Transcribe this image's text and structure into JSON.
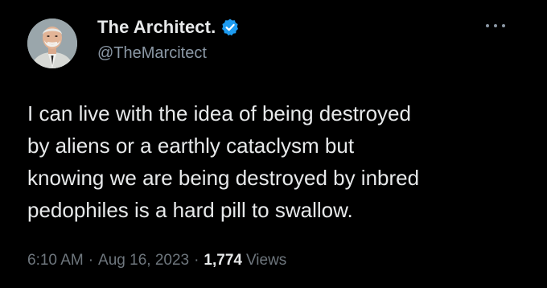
{
  "author": {
    "display_name": "The Architect.",
    "handle": "@TheMarcitect",
    "verified": true,
    "verified_color": "#1d9bf0"
  },
  "tweet": {
    "text": "I can live with the idea of being destroyed\nby aliens or a earthly cataclysm but\nknowing we are being destroyed by inbred\npedophiles is a hard pill to swallow.",
    "time": "6:10 AM",
    "separator": "·",
    "date": "Aug 16, 2023",
    "views_count": "1,774",
    "views_label": "Views"
  },
  "icons": {
    "more": "more-options-icon",
    "verified": "verified-badge-icon"
  },
  "colors": {
    "background": "#000000",
    "primary_text": "#e7e9ea",
    "secondary_text": "#8b98a5",
    "meta_text": "#6e767d"
  }
}
